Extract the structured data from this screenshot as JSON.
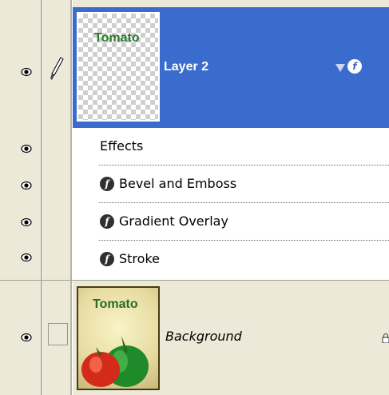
{
  "layers": [
    {
      "name": "Layer 2",
      "thumbnail_text": "Tomato",
      "selected": true,
      "effects_label": "Effects",
      "effects": [
        "Bevel and Emboss",
        "Gradient Overlay",
        "Stroke"
      ],
      "fx_icon": "f"
    },
    {
      "name": "Background",
      "thumbnail_text": "Tomato"
    }
  ],
  "colors": {
    "selection": "#3a6ccd",
    "panel": "#ece9d8"
  },
  "icons": {
    "visibility": "eye-icon",
    "brush": "brush-icon",
    "effect": "fx-icon",
    "lock": "lock-icon"
  }
}
